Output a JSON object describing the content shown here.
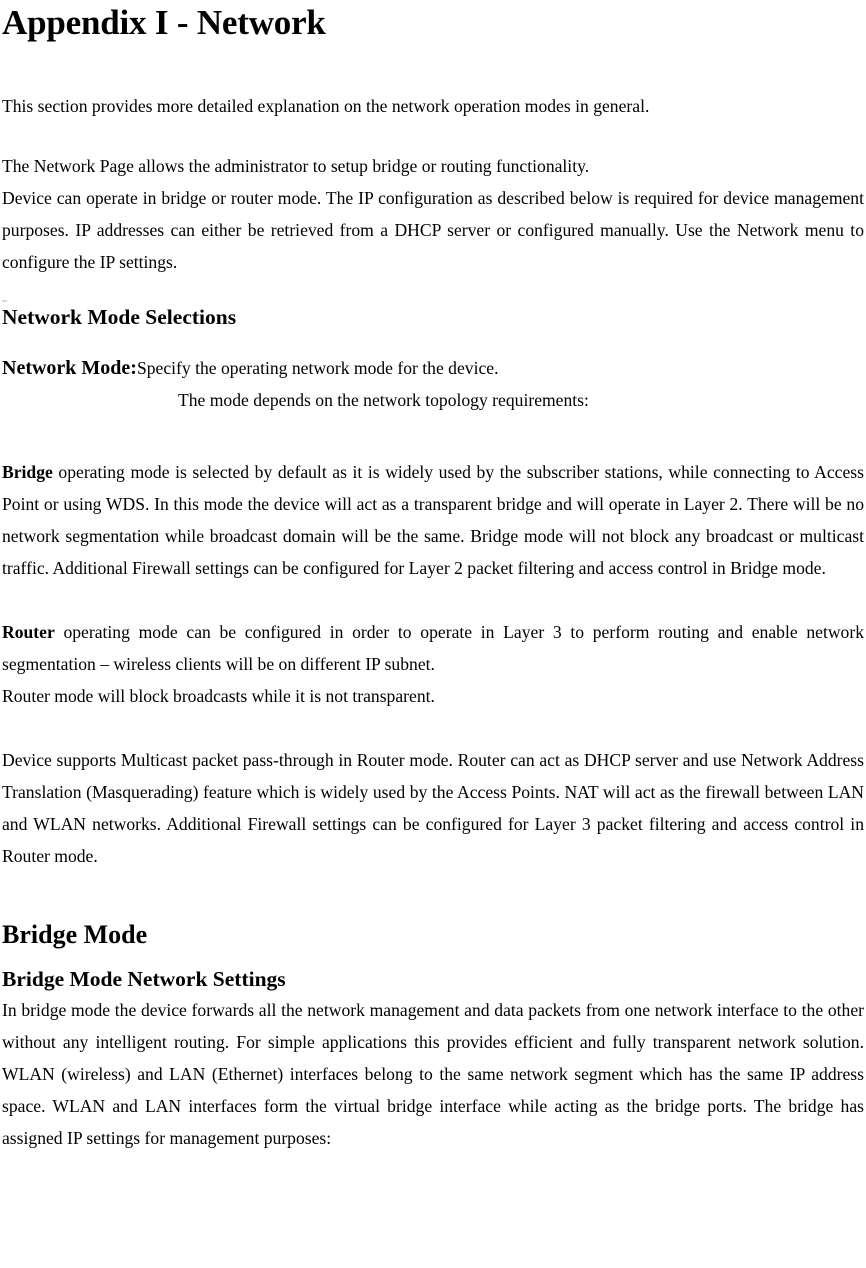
{
  "document": {
    "title": "Appendix I - Network",
    "intro": "This section provides more detailed explanation on the network operation modes in general.",
    "overview": {
      "line1": "The Network Page allows the administrator to setup bridge or routing functionality.",
      "body": "Device can operate in bridge or router mode. The IP configuration as described below is required for device management purposes. IP addresses can either be retrieved from a DHCP server or configured manually. Use the Network menu to configure the IP settings."
    },
    "mode_selections": {
      "heading": "Network Mode Selections",
      "term": "Network Mode:",
      "term_desc": "Specify the operating network mode for the device.",
      "term_desc_line2": "The mode depends on the network topology requirements:"
    },
    "bridge_paragraph": {
      "lead": "Bridge",
      "text": " operating mode is selected by default as it is widely used by the subscriber stations, while connecting to Access Point or using WDS. In this mode the device will act as a transparent bridge and will operate in Layer 2. There will be no network segmentation while broadcast domain will be the same. Bridge mode will not block any broadcast or multicast traffic. Additional Firewall settings can be configured for Layer 2 packet filtering and access control in Bridge mode."
    },
    "router_paragraph": {
      "lead": "Router",
      "text": " operating mode can be configured in order to operate in Layer 3 to perform routing and enable network segmentation – wireless clients will be on different IP subnet.",
      "line2": "Router mode will block broadcasts while it is not transparent."
    },
    "multicast_paragraph": {
      "text": "Device supports Multicast packet pass-through in Router mode. Router can act as DHCP server and use Network Address Translation (Masquerading) feature which is widely used by the Access Points. NAT will act as the firewall between LAN and WLAN networks. Additional Firewall settings can be configured for Layer 3 packet filtering and access control in Router mode."
    },
    "bridge_mode_section": {
      "heading": "Bridge Mode",
      "subheading": "Bridge Mode Network Settings",
      "body": "In bridge mode the device forwards all the network management and data packets from one network interface to the other without any intelligent routing. For simple applications this provides efficient and fully transparent network solution. WLAN (wireless) and LAN (Ethernet) interfaces belong to the same network segment which has the same IP address space. WLAN and LAN interfaces form the virtual bridge interface while acting as the bridge ports. The bridge has assigned IP settings for management purposes:"
    }
  }
}
